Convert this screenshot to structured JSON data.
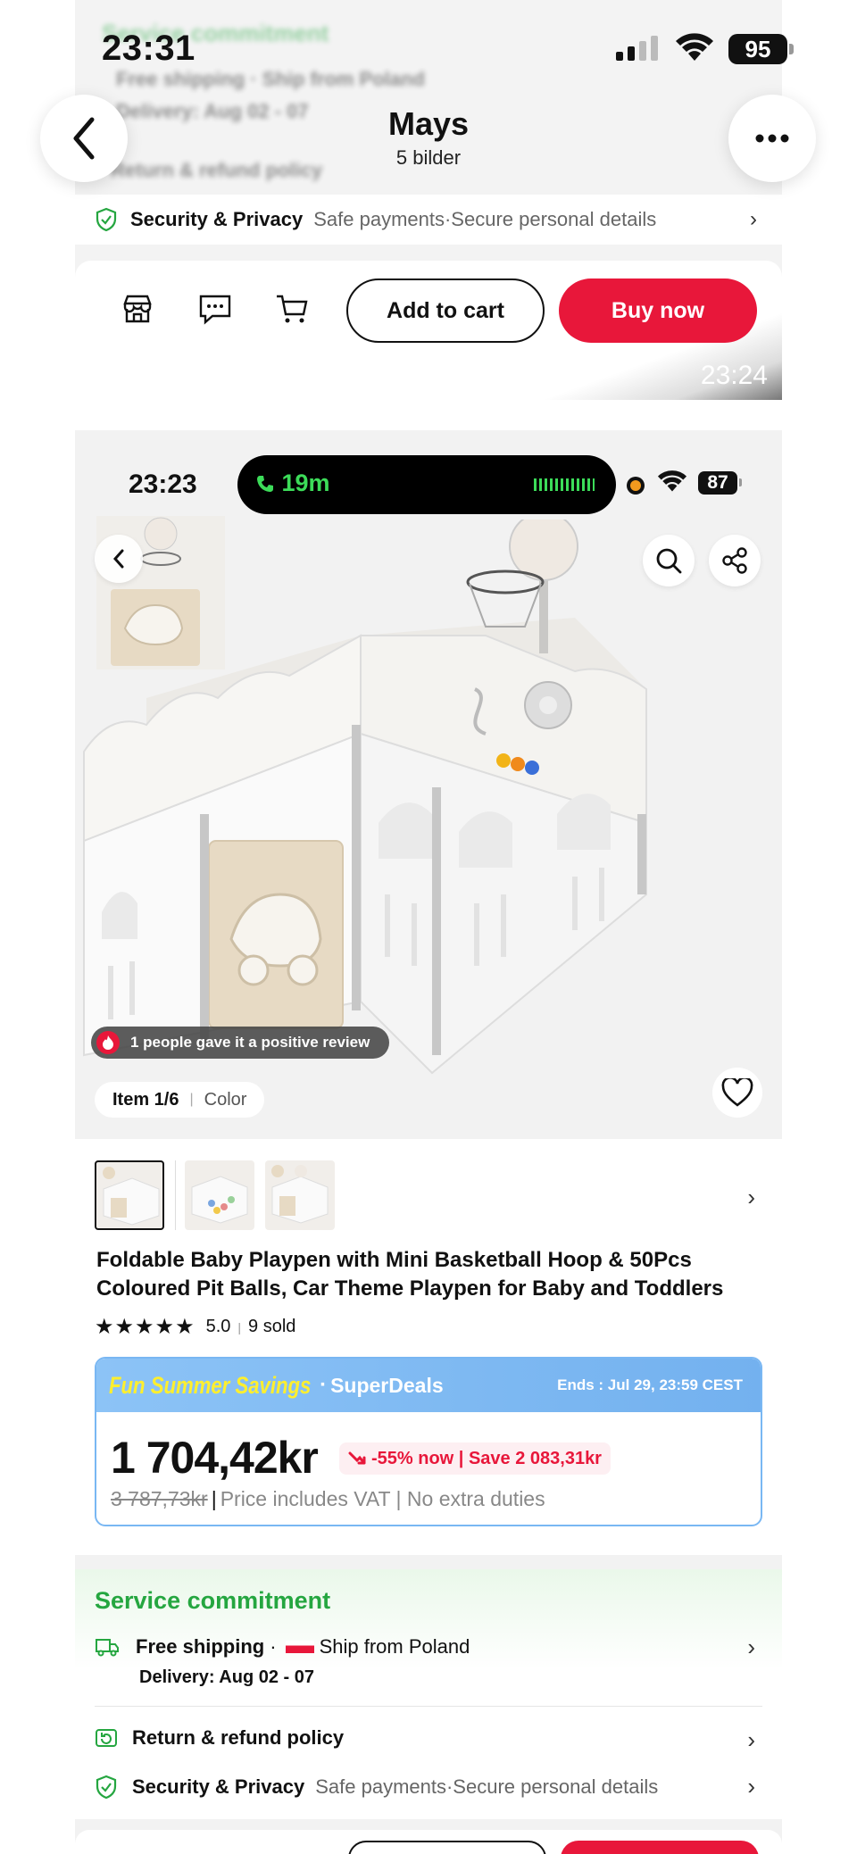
{
  "status_bar": {
    "time": "23:31",
    "battery": "95"
  },
  "viewer": {
    "title": "Mays",
    "subtitle": "5 bilder"
  },
  "top_fragment": {
    "service_blur_title": "Service commitment",
    "free_shipping_blur": "Free shipping · Ship from Poland",
    "delivery_blur": "Delivery: Aug 02 - 07",
    "return_blur": "Return & refund policy",
    "security_label": "Security & Privacy",
    "security_desc": "Safe payments·Secure personal details",
    "add_to_cart": "Add to cart",
    "buy_now": "Buy now",
    "timestamp": "23:24"
  },
  "inner_status": {
    "time": "23:23",
    "call_duration": "19m",
    "battery": "87"
  },
  "gallery": {
    "review_badge": "1 people gave it a positive review",
    "item_counter": "Item 1/6",
    "item_variant": "Color"
  },
  "product": {
    "title": "Foldable Baby Playpen with Mini Basketball Hoop & 50Pcs Coloured Pit Balls, Car Theme Playpen for Baby and Toddlers",
    "rating": "5.0",
    "stars": "★★★★★",
    "sold": "9 sold",
    "thumbnail_count": 3
  },
  "deal": {
    "campaign": "Fun Summer Savings",
    "brand": "SuperDeals",
    "ends": "Ends : Jul 29, 23:59 CEST",
    "price": "1 704,42kr",
    "discount": "-55% now | Save 2 083,31kr",
    "original_price": "3 787,73kr",
    "vat_note": "Price includes VAT | No extra duties",
    "colors": {
      "header": "#80bbf3",
      "fun_text": "#ffef2e",
      "accent": "#e8173a"
    }
  },
  "service": {
    "title": "Service commitment",
    "free_shipping": "Free shipping",
    "ship_from": "Ship from Poland",
    "delivery": "Delivery: Aug 02 - 07",
    "return_policy": "Return & refund policy",
    "security_label": "Security & Privacy",
    "security_desc": "Safe payments·Secure personal details",
    "title_color": "#25a640"
  }
}
